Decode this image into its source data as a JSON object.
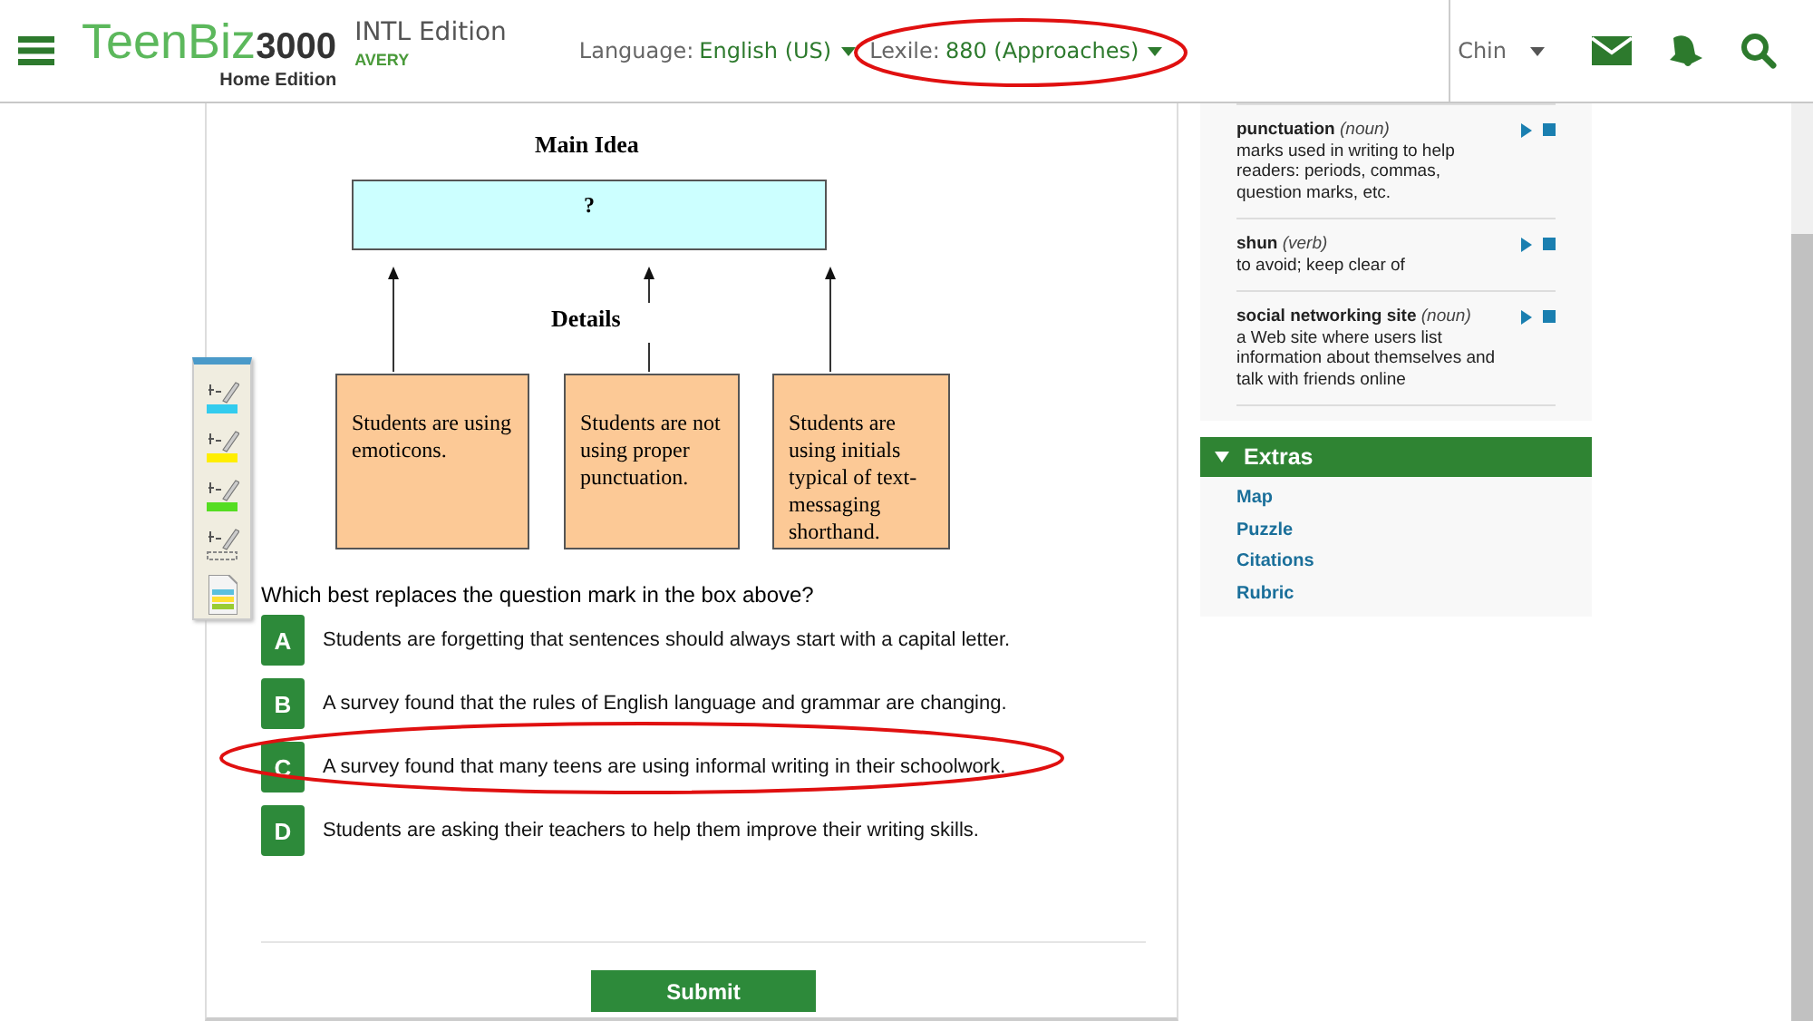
{
  "header": {
    "logo": "TeenBiz**3000**",
    "logo_subtitle": "Home Edition",
    "edition": "INTL Edition",
    "user": "AVERY",
    "language": {
      "label": "Language:",
      "value": "English (US)"
    },
    "lexile": {
      "label": "Lexile:",
      "value": "880 (Approaches)",
      "circled": true
    },
    "account": "Chin"
  },
  "highlighter_tools": [
    {
      "kind": "marker",
      "color": "#33ccee"
    },
    {
      "kind": "marker",
      "color": "#ffee00"
    },
    {
      "kind": "marker",
      "color": "#55dd22"
    },
    {
      "kind": "eraser"
    },
    {
      "kind": "notes"
    }
  ],
  "diagram": {
    "title": "Main Idea",
    "main_box": "?",
    "details_label": "Details",
    "details": [
      "Students are using emoticons.",
      "Students are not using proper punctuation.",
      "Students are using initials typical of text-messaging shorthand."
    ]
  },
  "question": "Which best replaces the question mark in the box above?",
  "options": [
    {
      "letter": "A",
      "text": "Students are forgetting that sentences should always start with a capital letter.",
      "circled": false
    },
    {
      "letter": "B",
      "text": "A survey found that the rules of English language and grammar are changing.",
      "circled": false
    },
    {
      "letter": "C",
      "text": "A survey found that many teens are using informal writing in their schoolwork.",
      "circled": true
    },
    {
      "letter": "D",
      "text": "Students are asking their teachers to help them improve their writing skills.",
      "circled": false
    }
  ],
  "submit": "Submit",
  "vocabulary": [
    {
      "word": "punctuation",
      "pos": "(noun)",
      "definition": "marks used in writing to help readers: periods, commas, question marks, etc."
    },
    {
      "word": "shun",
      "pos": "(verb)",
      "definition": "to avoid; keep clear of"
    },
    {
      "word": "social networking site",
      "pos": "(noun)",
      "definition": "a Web site where users list information about themselves and talk with friends online"
    }
  ],
  "extras": {
    "title": "Extras",
    "expanded": true,
    "links": [
      "Map",
      "Puzzle",
      "Citations",
      "Rubric"
    ]
  }
}
